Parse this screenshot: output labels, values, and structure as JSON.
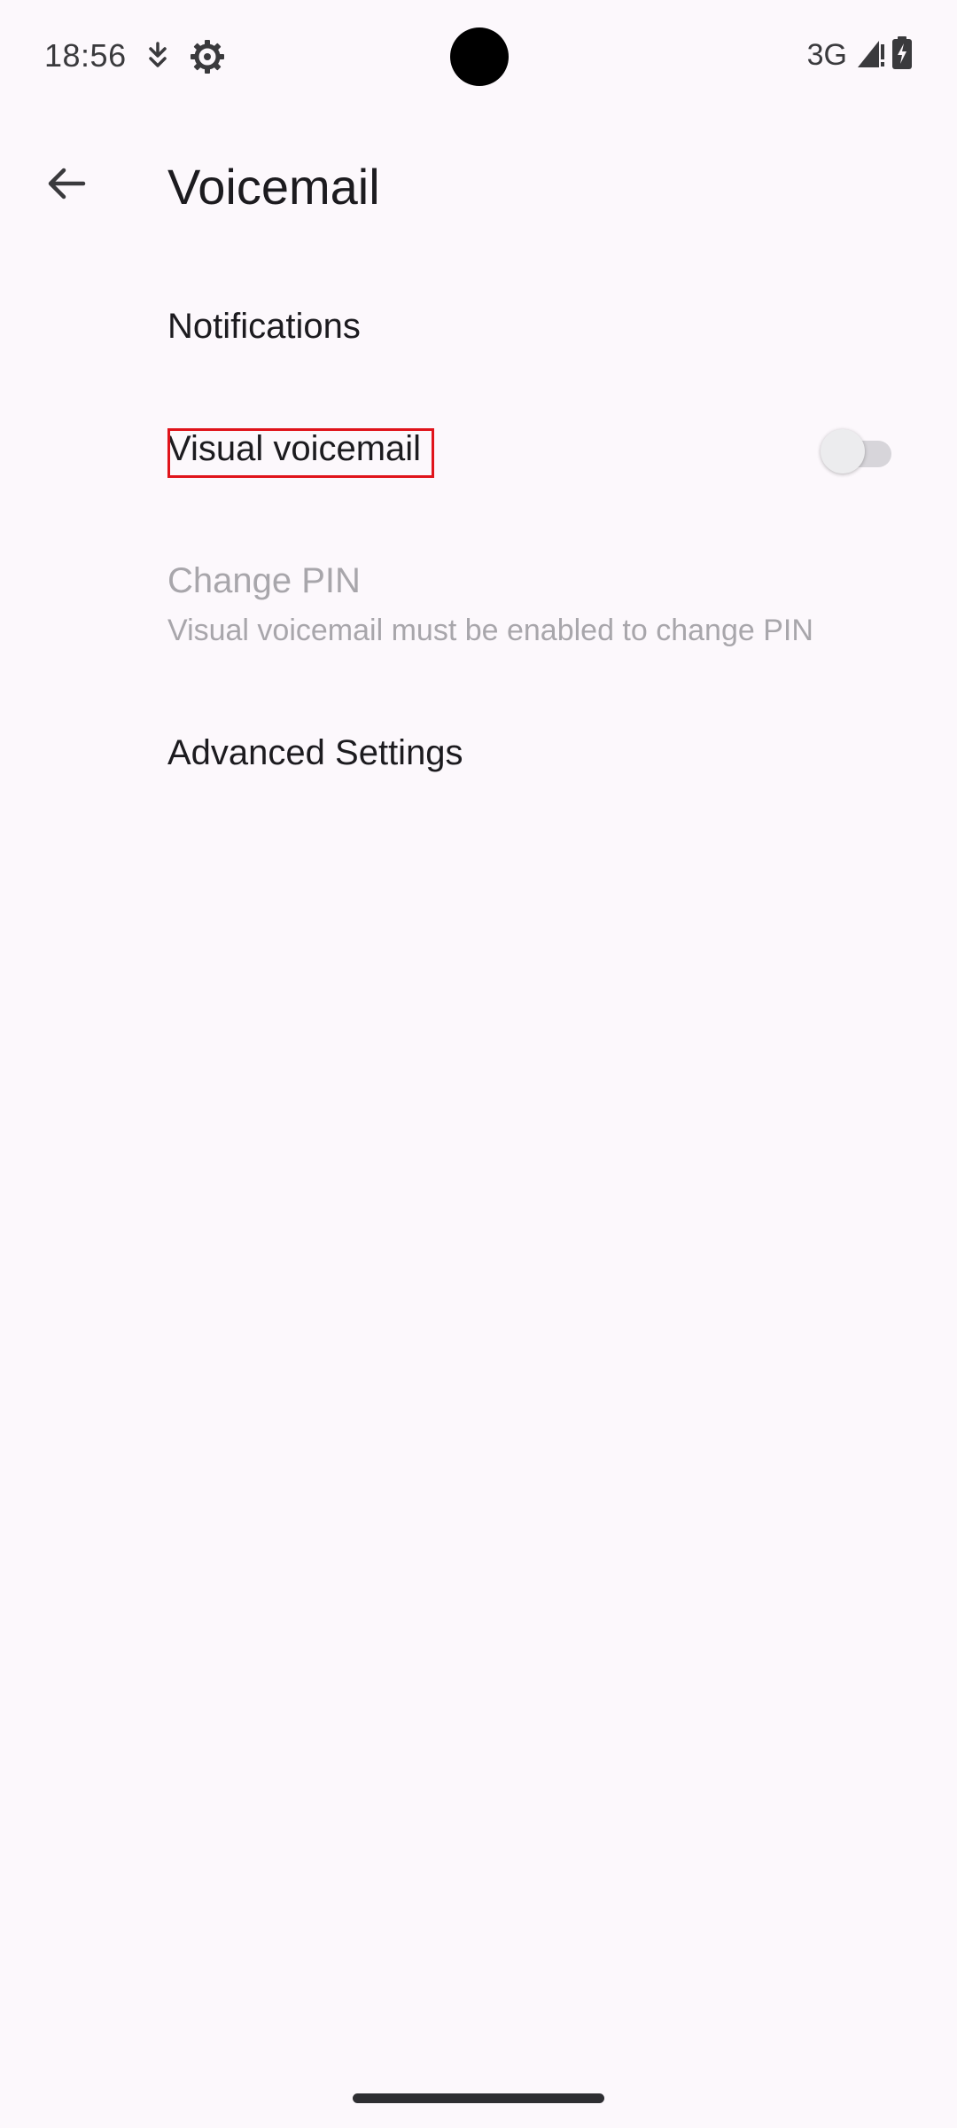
{
  "status_bar": {
    "time": "18:56",
    "icons_left": [
      "download-arrow-icon",
      "settings-gear-icon"
    ],
    "network": "3G",
    "icons_right": [
      "cell-signal-icon",
      "battery-charging-icon"
    ]
  },
  "app_bar": {
    "back_icon": "arrow-back-icon",
    "title": "Voicemail"
  },
  "preferences": {
    "notifications": {
      "title": "Notifications"
    },
    "visual_voicemail": {
      "title": "Visual voicemail",
      "enabled": false
    },
    "change_pin": {
      "title": "Change PIN",
      "summary": "Visual voicemail must be enabled to change PIN",
      "disabled": true
    },
    "advanced_settings": {
      "title": "Advanced Settings"
    }
  },
  "colors": {
    "background": "#fcf8fc",
    "text_primary": "#1c1b1f",
    "text_disabled": "#a8a6ab",
    "highlight": "#e0141b",
    "switch_track_off": "#d7d5da"
  }
}
